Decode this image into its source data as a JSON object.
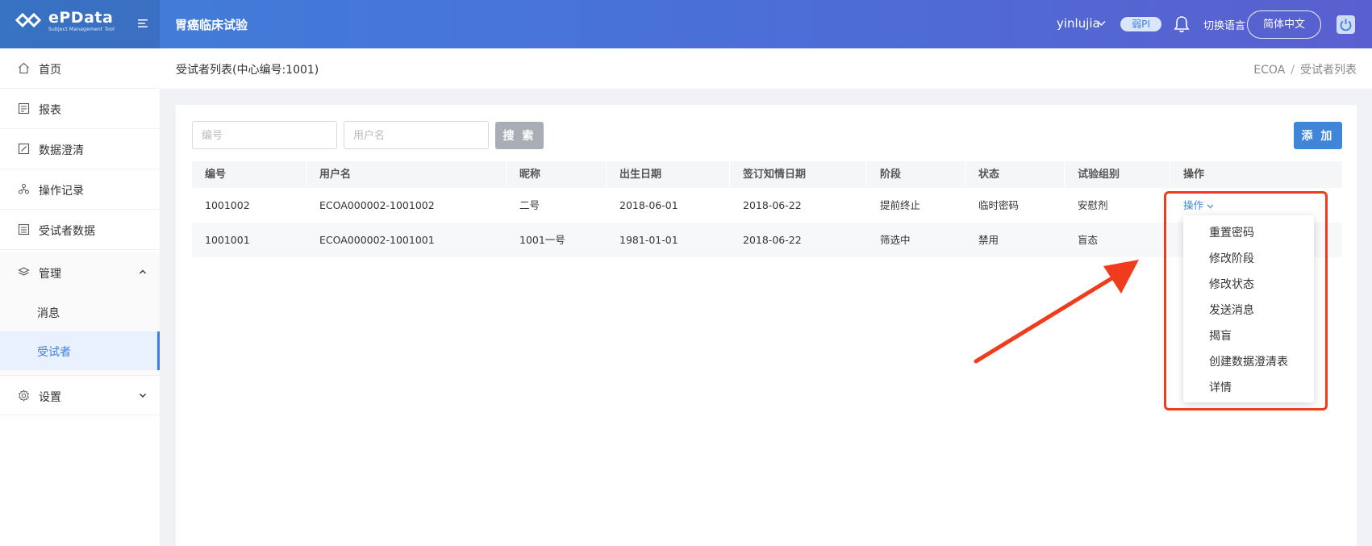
{
  "header": {
    "logo_text": "ePData",
    "logo_sub": "Subject Management Tool",
    "project_title": "胃癌临床试验",
    "user_name": "yinlujia",
    "role_badge": "弱PI",
    "lang_label": "切换语言",
    "lang_button": "简体中文"
  },
  "sidebar": {
    "items": [
      {
        "label": "首页",
        "icon": "home-icon"
      },
      {
        "label": "报表",
        "icon": "report-icon"
      },
      {
        "label": "数据澄清",
        "icon": "edit-icon"
      },
      {
        "label": "操作记录",
        "icon": "record-icon"
      },
      {
        "label": "受试者数据",
        "icon": "data-icon"
      }
    ],
    "manage_label": "管理",
    "manage_subitems": [
      "消息",
      "受试者"
    ],
    "settings_label": "设置"
  },
  "page": {
    "heading": "受试者列表(中心编号:1001)",
    "breadcrumb": [
      "ECOA",
      "受试者列表"
    ]
  },
  "filters": {
    "number_placeholder": "编号",
    "username_placeholder": "用户名",
    "search_label": "搜 索",
    "add_label": "添 加"
  },
  "table": {
    "columns": [
      "编号",
      "用户名",
      "昵称",
      "出生日期",
      "签订知情日期",
      "阶段",
      "状态",
      "试验组别",
      "操作"
    ],
    "rows": [
      [
        "1001002",
        "ECOA000002-1001002",
        "二号",
        "2018-06-01",
        "2018-06-22",
        "提前终止",
        "临时密码",
        "安慰剂",
        "操作"
      ],
      [
        "1001001",
        "ECOA000002-1001001",
        "1001一号",
        "1981-01-01",
        "2018-06-22",
        "筛选中",
        "禁用",
        "盲态",
        ""
      ]
    ]
  },
  "dropdown": {
    "items": [
      "重置密码",
      "修改阶段",
      "修改状态",
      "发送消息",
      "揭盲",
      "创建数据澄清表",
      "详情"
    ]
  },
  "colors": {
    "primary": "#3f86d9",
    "highlight": "#f03c1c"
  }
}
